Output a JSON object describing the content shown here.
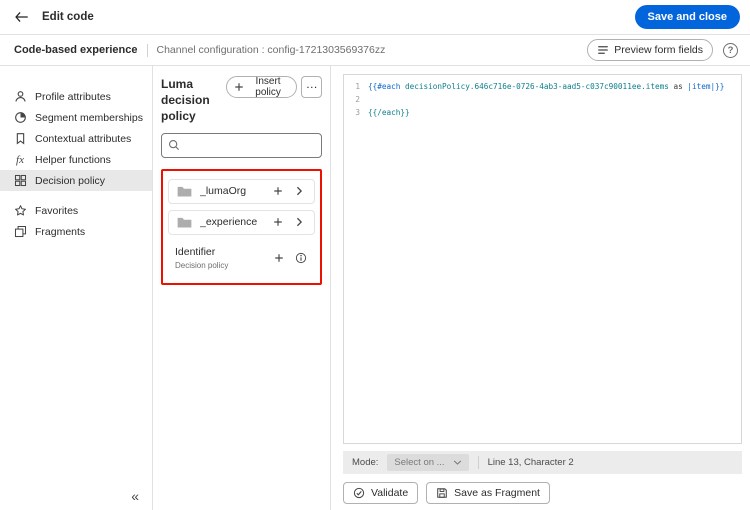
{
  "colors": {
    "accent": "#0265dc",
    "annotation": "#eb1000"
  },
  "header": {
    "title": "Edit code",
    "save_button": "Save and close"
  },
  "subheader": {
    "title": "Code-based experience",
    "channel_config": "Channel configuration : config-1721303569376zz",
    "preview_button": "Preview form fields"
  },
  "sidebar": {
    "items": [
      {
        "id": "profile-attributes",
        "label": "Profile attributes",
        "icon": "user-icon",
        "selected": false
      },
      {
        "id": "segment-memberships",
        "label": "Segment memberships",
        "icon": "segment-icon",
        "selected": false
      },
      {
        "id": "contextual-attributes",
        "label": "Contextual attributes",
        "icon": "contextual-icon",
        "selected": false
      },
      {
        "id": "helper-functions",
        "label": "Helper functions",
        "icon": "fx-icon",
        "selected": false
      },
      {
        "id": "decision-policy",
        "label": "Decision policy",
        "icon": "decision-policy-icon",
        "selected": true
      },
      {
        "id": "favorites",
        "label": "Favorites",
        "icon": "star-icon",
        "selected": false,
        "gap_before": true
      },
      {
        "id": "fragments",
        "label": "Fragments",
        "icon": "fragment-icon",
        "selected": false
      }
    ],
    "collapse_label": "«"
  },
  "policy_panel": {
    "title": "Luma decision policy",
    "insert_button": "Insert policy",
    "more_button": "…",
    "search_placeholder": "",
    "tree": [
      {
        "label": "_lumaOrg",
        "icon": "folder-icon",
        "card": true,
        "actions": [
          "plus",
          "chevron-right"
        ]
      },
      {
        "label": "_experience",
        "icon": "folder-icon",
        "card": true,
        "actions": [
          "plus",
          "chevron-right"
        ]
      },
      {
        "label": "Identifier",
        "subtitle": "Decision policy",
        "icon": null,
        "card": false,
        "actions": [
          "plus",
          "info"
        ]
      }
    ]
  },
  "editor": {
    "lines": [
      {
        "number": "1",
        "tokens": [
          {
            "text": "{{#each ",
            "color": "#0d66d0"
          },
          {
            "text": "decisionPolicy.646c716e-0726-4ab3-aad5-c037c90011ee.items",
            "color": "#0d7f8c"
          },
          {
            "text": " as ",
            "color": "#3b3b3b"
          },
          {
            "text": "|item|",
            "color": "#0d66d0"
          },
          {
            "text": "}}",
            "color": "#0d66d0"
          }
        ]
      },
      {
        "number": "2",
        "tokens": []
      },
      {
        "number": "3",
        "tokens": [
          {
            "text": "{{/each}}",
            "color": "#0d7f8c"
          }
        ]
      }
    ],
    "statusbar": {
      "mode_label": "Mode:",
      "mode_value": "Select on ...",
      "position": "Line 13, Character 2"
    },
    "actions": {
      "validate": "Validate",
      "save_fragment": "Save as Fragment"
    }
  }
}
